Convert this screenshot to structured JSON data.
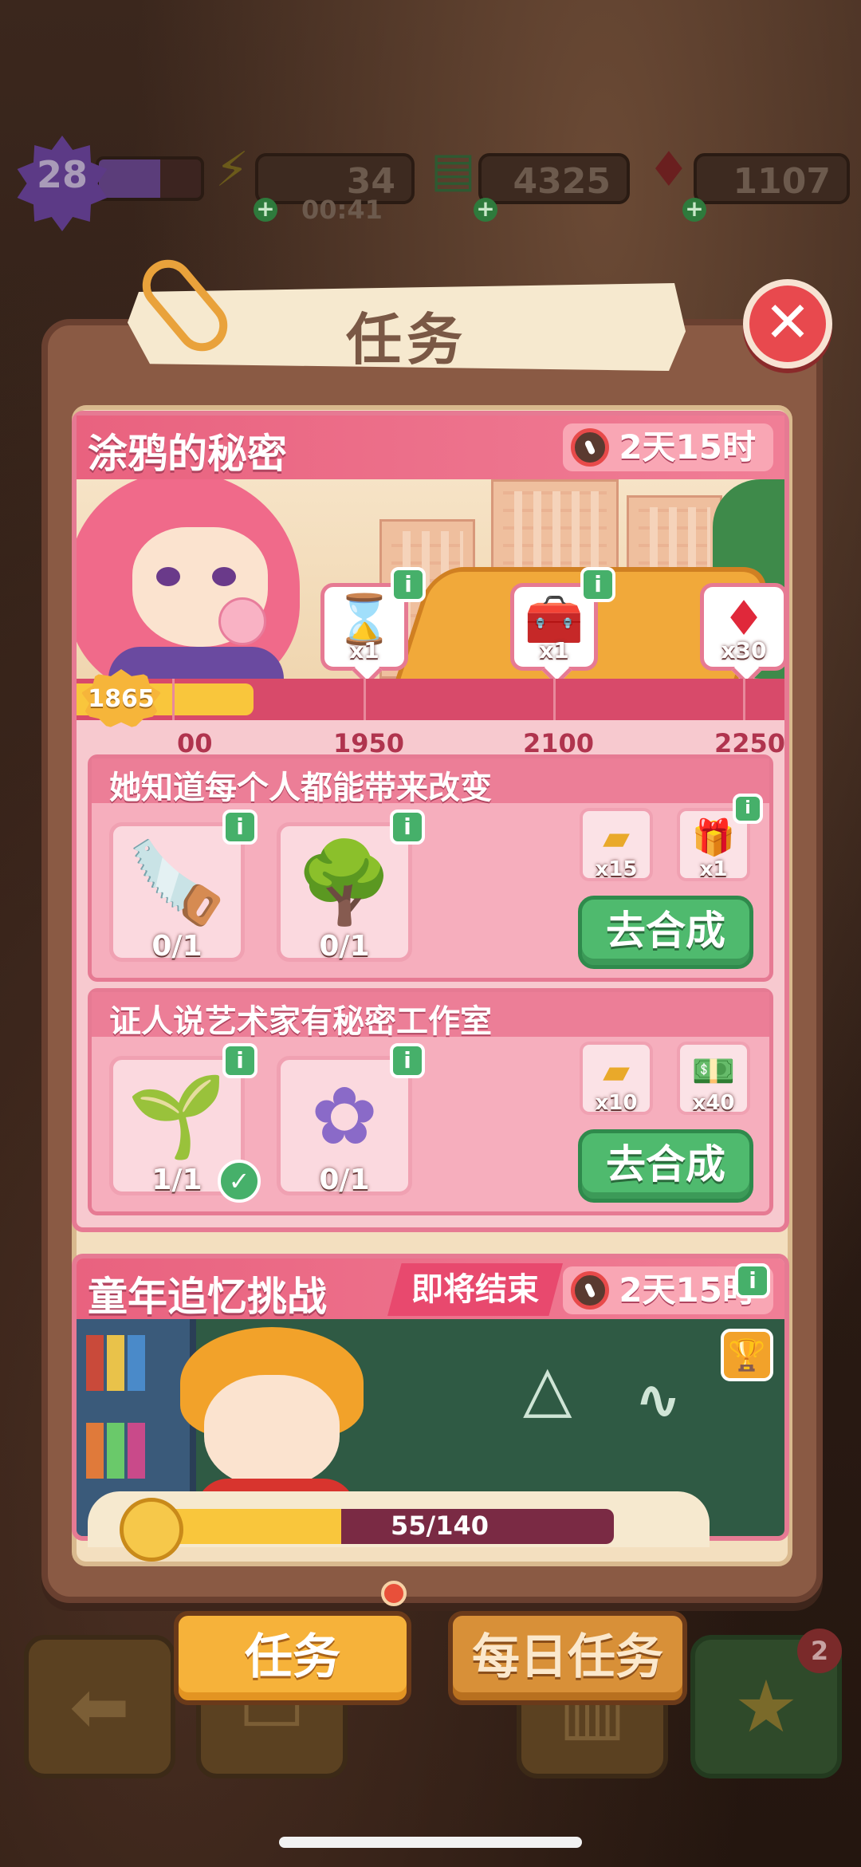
{
  "status_bar": {
    "level": "28",
    "energy": "34",
    "energy_timer": "00:41",
    "cash": "4325",
    "gems": "1107"
  },
  "modal": {
    "title": "任务",
    "close_label": "✕"
  },
  "event1": {
    "title": "涂鸦的秘密",
    "timer": "2天15时",
    "points": "1865",
    "progress_fraction": 0.25,
    "milestones": [
      "00",
      "1950",
      "2100",
      "2250"
    ],
    "rewards": [
      {
        "icon": "hourglass-icon",
        "glyph": "⌛",
        "qty": "x1"
      },
      {
        "icon": "treasure-chest-icon",
        "glyph": "🧰",
        "qty": "x1"
      },
      {
        "icon": "ruby-icon",
        "glyph": "♦",
        "qty": "x30"
      }
    ],
    "info_label": "i"
  },
  "tasks": [
    {
      "title": "她知道每个人都能带来改变",
      "items": [
        {
          "icon": "saw-icon",
          "glyph": "🪚",
          "count": "0/1"
        },
        {
          "icon": "flower-tree-icon",
          "glyph": "🌳",
          "count": "0/1"
        }
      ],
      "rewards": [
        {
          "icon": "gold-bar-icon",
          "glyph": "▰",
          "qty": "x15"
        },
        {
          "icon": "gift-box-icon",
          "glyph": "🎁",
          "qty": "x1"
        }
      ],
      "button": "去合成"
    },
    {
      "title": "证人说艺术家有秘密工作室",
      "items": [
        {
          "icon": "sprout-pot-icon",
          "glyph": "🌱",
          "count": "1/1"
        },
        {
          "icon": "cotton-flower-icon",
          "glyph": "✿",
          "count": "0/1"
        }
      ],
      "rewards": [
        {
          "icon": "gold-bar-icon",
          "glyph": "▰",
          "qty": "x10"
        },
        {
          "icon": "cash-icon",
          "glyph": "💵",
          "qty": "x40"
        }
      ],
      "button": "去合成"
    }
  ],
  "event2": {
    "title": "童年追忆挑战",
    "tag": "即将结束",
    "timer": "2天15时",
    "progress": "55/140",
    "progress_fraction": 0.39
  },
  "tabs": {
    "active": "任务",
    "daily": "每日任务"
  },
  "bottom_nav": {
    "badge": "2"
  },
  "colors": {
    "accent_pink": "#e9627f",
    "go_green": "#4fba6e",
    "tab_orange": "#f6b23a"
  }
}
